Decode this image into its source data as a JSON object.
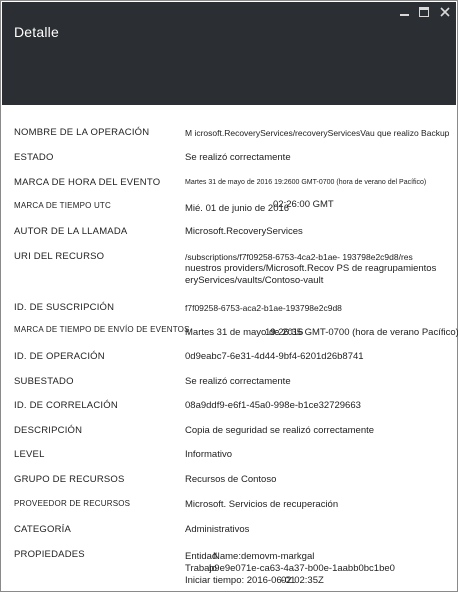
{
  "window": {
    "title": "Detalle"
  },
  "details": [
    {
      "key": "NOMBRE DE LA OPERACIÓN",
      "lines": [
        "M icrosoft.RecoveryServices/recoveryServicesVau que realizo Backup"
      ]
    },
    {
      "key": "ESTADO",
      "lines": [
        "Se realizó correctamente"
      ]
    },
    {
      "key": "MARCA DE HORA DEL EVENTO",
      "lines": [
        "Martes 31 de mayo de 2016 19:2600 GMT-0700 (hora de verano del Pacífico)"
      ]
    },
    {
      "key": "MARCA DE TIEMPO UTC",
      "lines": [
        "Mié. 01 de junio de 2016",
        "02:26:00 GMT"
      ]
    },
    {
      "key": "AUTOR DE LA LLAMADA",
      "lines": [
        "Microsoft.RecoveryServices"
      ]
    },
    {
      "key": "URI DEL RECURSO",
      "lines": [
        "/subscriptions/f7f09258-6753-4ca2-b1ae- 193798e2c9d8/res",
        "nuestros providers/Microsoft.Recov PS de reagrupamientos",
        "eryServices/vaults/Contoso-vault"
      ]
    },
    {
      "key": "ID. DE SUSCRIPCIÓN",
      "lines": [
        "f7f09258-6753-aca2-b1ae-193798e2c9d8"
      ]
    },
    {
      "key": "MARCA DE TIEMPO DE ENVÍO DE EVENTOS",
      "lines": [
        "Martes 31 de mayo de 2016",
        "19:26:35 GMT-0700 (hora de verano Pacífico)"
      ]
    },
    {
      "key": "ID. DE OPERACIÓN",
      "lines": [
        "0d9eabc7-6e31-4d44-9bf4-6201d26b8741"
      ]
    },
    {
      "key": "SUBESTADO",
      "lines": [
        "Se realizó correctamente"
      ]
    },
    {
      "key": "ID. DE CORRELACIÓN",
      "lines": [
        "08a9ddf9-e6f1-45a0-998e-b1ce32729663"
      ]
    },
    {
      "key": "DESCRIPCIÓN",
      "lines": [
        "Copia de seguridad se realizó correctamente"
      ]
    },
    {
      "key": "LEVEL",
      "lines": [
        "Informativo"
      ]
    },
    {
      "key": "GRUPO DE RECURSOS",
      "lines": [
        "Recursos de Contoso"
      ]
    },
    {
      "key": "PROVEEDOR DE RECURSOS",
      "lines": [
        "Microsoft. Servicios de recuperación"
      ]
    },
    {
      "key": "CATEGORÍA",
      "lines": [
        "Administrativos"
      ]
    },
    {
      "key": "PROPIEDADES",
      "lines": [
        "Entidad",
        "Name:demovm-markgal",
        "Trabajo",
        "b9e9e071e-ca63-4a37-b00e-1aabb0bc1be0",
        "Iniciar tiempo: 2016-06-01",
        "02:02:35Z"
      ]
    }
  ]
}
